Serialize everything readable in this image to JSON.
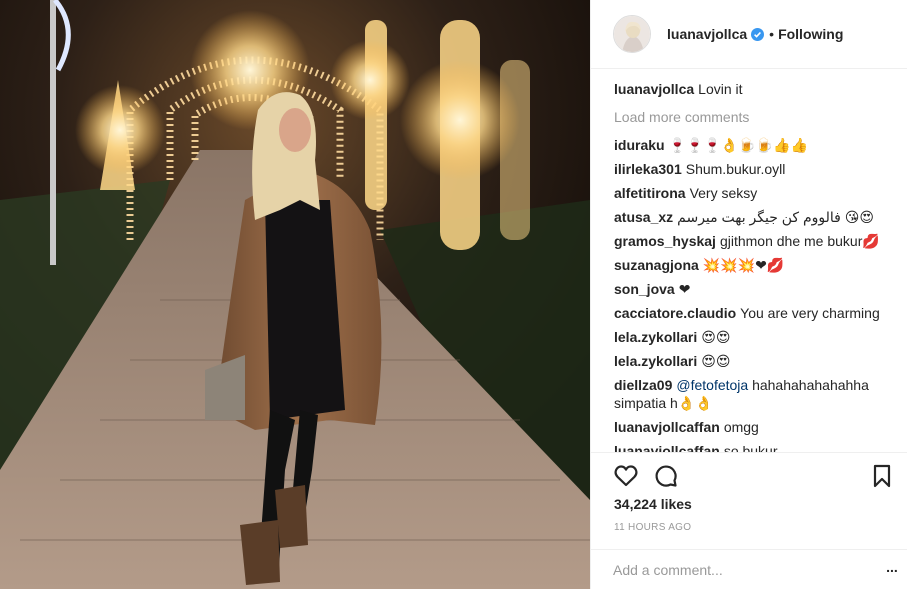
{
  "post": {
    "author": "luanavjollca",
    "follow_status": "Following",
    "dot": "•",
    "caption_user": "luanavjollca",
    "caption_text": "Lovin it",
    "load_more": "Load more comments",
    "comments": [
      {
        "user": "iduraku",
        "text": "🍷🍷🍷👌🍺🍺👍👍"
      },
      {
        "user": "ilirleka301",
        "text": "Shum.bukur.oyll"
      },
      {
        "user": "alfetitirona",
        "text": "Very seksy"
      },
      {
        "user": "atusa_xz",
        "text": "فالووم کن جیگر بهت میرسم 😘😍"
      },
      {
        "user": "gramos_hyskaj",
        "text": "gjithmon dhe me bukur💋"
      },
      {
        "user": "suzanagjona",
        "text": "💥💥💥❤💋"
      },
      {
        "user": "son_jova",
        "text": "❤"
      },
      {
        "user": "cacciatore.claudio",
        "text": "You are very charming"
      },
      {
        "user": "lela.zykollari",
        "text": "😍😍"
      },
      {
        "user": "lela.zykollari",
        "text": "😍😍"
      },
      {
        "user": "diellza09",
        "mention": "@fetofetoja",
        "text": "hahahahahahahha simpatia h👌👌"
      },
      {
        "user": "luanavjollcaffan",
        "text": "omgg"
      },
      {
        "user": "luanavjollcaffan",
        "text": "so bukur"
      }
    ],
    "likes": "34,224 likes",
    "timestamp": "11 HOURS AGO",
    "add_comment_placeholder": "Add a comment...",
    "more_label": "..."
  },
  "icons": {
    "like": "heart-icon",
    "comment": "comment-icon",
    "save": "bookmark-icon",
    "verified": "verified-badge-icon"
  },
  "colors": {
    "verified": "#3897f0",
    "secondary_text": "#999999",
    "mention": "#003569",
    "border": "#efefef"
  }
}
